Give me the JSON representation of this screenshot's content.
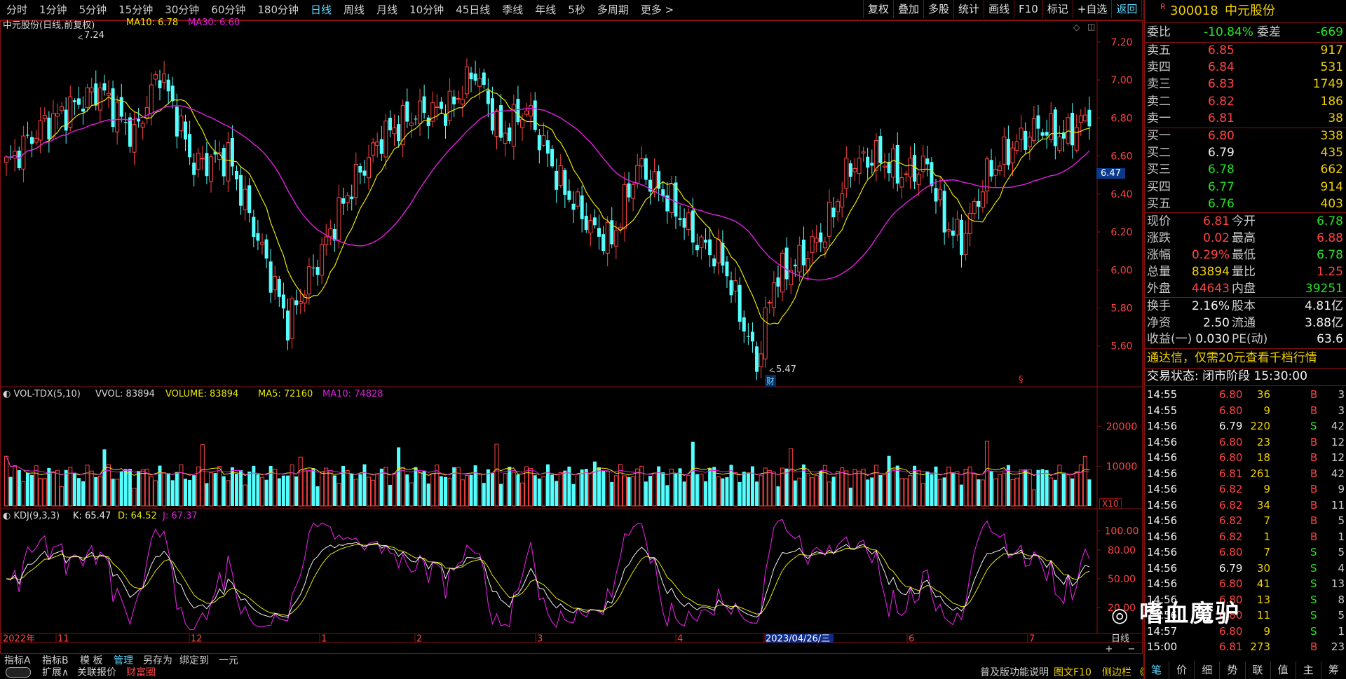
{
  "toolbar": {
    "periods": [
      "分时",
      "1分钟",
      "5分钟",
      "15分钟",
      "30分钟",
      "60分钟",
      "180分钟",
      "日线",
      "周线",
      "月线",
      "10分钟",
      "45日线",
      "季线",
      "年线",
      "5秒",
      "多周期",
      "更多 >"
    ],
    "active_period": "日线",
    "right_buttons": [
      "复权",
      "叠加",
      "多股",
      "统计",
      "画线",
      "F10",
      "标记",
      "+自选",
      "返回"
    ]
  },
  "main_chart": {
    "title": "中元股份(日线,前复权)",
    "ma10_label": "MA10: 6.78",
    "ma30_label": "MA30: 6.60",
    "high_label": "7.24",
    "low_label": "5.47",
    "current_price_tag": "6.47",
    "cai_badge": "财",
    "s_marker": "§",
    "y_ticks": [
      "7.20",
      "7.00",
      "6.80",
      "6.60",
      "6.40",
      "6.20",
      "6.00",
      "5.80",
      "5.60"
    ]
  },
  "volume_chart": {
    "title": "VOL-TDX(5,10)",
    "vvol_label": "VVOL: 83894",
    "volume_label": "VOLUME: 83894",
    "ma5_label": "MA5: 72160",
    "ma10_label": "MA10: 74828",
    "y_ticks": [
      "20000",
      "10000"
    ],
    "unit": "X10"
  },
  "kdj_chart": {
    "title": "KDJ(9,3,3)",
    "k_label": "K: 65.47",
    "d_label": "D: 64.52",
    "j_label": "J: 67.37",
    "y_ticks": [
      "100.00",
      "80.00",
      "50.00",
      "20.00"
    ]
  },
  "x_axis": {
    "labels": [
      "2022年",
      "11",
      "12",
      "1",
      "2",
      "3",
      "4",
      "2023/04/26/三",
      "6",
      "7"
    ],
    "period_tag": "日线"
  },
  "bottom_tabs": {
    "row1": [
      "指标A",
      "指标B",
      "模 板",
      "管理",
      "另存为",
      "绑定到",
      "一元"
    ],
    "row2": [
      "扩展∧",
      "关联报价",
      "财富圈"
    ],
    "active": "管理",
    "right_info": "普及版功能说明",
    "right_f10": "图文F10",
    "right_side": "侧边栏 《"
  },
  "quote": {
    "badge": "R",
    "code": "300018",
    "name": "中元股份",
    "weibi_label": "委比",
    "weibi": "-10.84%",
    "weicha_label": "委差",
    "weicha": "-669",
    "asks": [
      {
        "label": "卖五",
        "price": "6.85",
        "vol": "917"
      },
      {
        "label": "卖四",
        "price": "6.84",
        "vol": "531"
      },
      {
        "label": "卖三",
        "price": "6.83",
        "vol": "1749"
      },
      {
        "label": "卖二",
        "price": "6.82",
        "vol": "186"
      },
      {
        "label": "卖一",
        "price": "6.81",
        "vol": "38"
      }
    ],
    "bids": [
      {
        "label": "买一",
        "price": "6.80",
        "vol": "338"
      },
      {
        "label": "买二",
        "price": "6.79",
        "vol": "435"
      },
      {
        "label": "买三",
        "price": "6.78",
        "vol": "662"
      },
      {
        "label": "买四",
        "price": "6.77",
        "vol": "914"
      },
      {
        "label": "买五",
        "price": "6.76",
        "vol": "403"
      }
    ],
    "stats": [
      {
        "l1": "现价",
        "v1": "6.81",
        "c1": "red",
        "l2": "今开",
        "v2": "6.78",
        "c2": "green"
      },
      {
        "l1": "涨跌",
        "v1": "0.02",
        "c1": "red",
        "l2": "最高",
        "v2": "6.88",
        "c2": "red"
      },
      {
        "l1": "涨幅",
        "v1": "0.29%",
        "c1": "red",
        "l2": "最低",
        "v2": "6.78",
        "c2": "green"
      },
      {
        "l1": "总量",
        "v1": "83894",
        "c1": "yellow",
        "l2": "量比",
        "v2": "1.25",
        "c2": "red"
      },
      {
        "l1": "外盘",
        "v1": "44643",
        "c1": "red",
        "l2": "内盘",
        "v2": "39251",
        "c2": "green"
      }
    ],
    "stats2": [
      {
        "l1": "换手",
        "v1": "2.16%",
        "l2": "股本",
        "v2": "4.81亿"
      },
      {
        "l1": "净资",
        "v1": "2.50",
        "l2": "流通",
        "v2": "3.88亿"
      },
      {
        "l1": "收益(一)",
        "v1": "0.030",
        "l2": "PE(动)",
        "v2": "63.6"
      }
    ],
    "promo": "通达信，仅需20元查看千档行情",
    "status": "交易状态: 闭市阶段 15:30:00",
    "ticks": [
      {
        "t": "14:55",
        "p": "6.80",
        "v": "36",
        "d": "B",
        "n": "3",
        "pc": "red"
      },
      {
        "t": "14:55",
        "p": "6.80",
        "v": "9",
        "d": "B",
        "n": "3",
        "pc": "red"
      },
      {
        "t": "14:56",
        "p": "6.79",
        "v": "220",
        "d": "S",
        "n": "42",
        "pc": "white"
      },
      {
        "t": "14:56",
        "p": "6.80",
        "v": "23",
        "d": "B",
        "n": "12",
        "pc": "red"
      },
      {
        "t": "14:56",
        "p": "6.80",
        "v": "18",
        "d": "B",
        "n": "12",
        "pc": "red"
      },
      {
        "t": "14:56",
        "p": "6.81",
        "v": "261",
        "d": "B",
        "n": "42",
        "pc": "red"
      },
      {
        "t": "14:56",
        "p": "6.82",
        "v": "9",
        "d": "B",
        "n": "9",
        "pc": "red"
      },
      {
        "t": "14:56",
        "p": "6.82",
        "v": "34",
        "d": "B",
        "n": "11",
        "pc": "red"
      },
      {
        "t": "14:56",
        "p": "6.82",
        "v": "7",
        "d": "B",
        "n": "5",
        "pc": "red"
      },
      {
        "t": "14:56",
        "p": "6.82",
        "v": "1",
        "d": "B",
        "n": "1",
        "pc": "red"
      },
      {
        "t": "14:56",
        "p": "6.80",
        "v": "7",
        "d": "S",
        "n": "5",
        "pc": "red"
      },
      {
        "t": "14:56",
        "p": "6.79",
        "v": "30",
        "d": "S",
        "n": "4",
        "pc": "white"
      },
      {
        "t": "14:56",
        "p": "6.80",
        "v": "41",
        "d": "S",
        "n": "13",
        "pc": "red"
      },
      {
        "t": "14:56",
        "p": "6.80",
        "v": "13",
        "d": "S",
        "n": "8",
        "pc": "red"
      },
      {
        "t": "14:56",
        "p": "6.80",
        "v": "11",
        "d": "S",
        "n": "5",
        "pc": "red"
      },
      {
        "t": "14:57",
        "p": "6.80",
        "v": "9",
        "d": "S",
        "n": "1",
        "pc": "red"
      },
      {
        "t": "15:00",
        "p": "6.81",
        "v": "273",
        "d": "B",
        "n": "23",
        "pc": "red"
      }
    ],
    "side_tabs": [
      "笔",
      "价",
      "细",
      "势",
      "联",
      "值",
      "主",
      "筹"
    ]
  },
  "watermark": "嗜血魔驴",
  "colors": {
    "up": "#ff4444",
    "down": "#54ffff",
    "ma10": "#e8e800",
    "ma30": "#e020e0",
    "frame": "#8a1010",
    "k": "#f0f0f0",
    "d": "#e8e800",
    "j": "#e020e0"
  }
}
